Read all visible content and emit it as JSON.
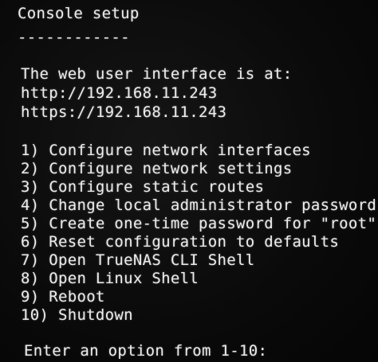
{
  "console": {
    "title": "Console setup",
    "title_rule": "------------",
    "web_ui_label": "The web user interface is at:",
    "http_url": "http://192.168.11.243",
    "https_url": "https://192.168.11.243",
    "menu": [
      {
        "number": "1)",
        "label": "Configure network interfaces"
      },
      {
        "number": "2)",
        "label": "Configure network settings"
      },
      {
        "number": "3)",
        "label": "Configure static routes"
      },
      {
        "number": "4)",
        "label": "Change local administrator password"
      },
      {
        "number": "5)",
        "label": "Create one-time password for \"root\""
      },
      {
        "number": "6)",
        "label": "Reset configuration to defaults"
      },
      {
        "number": "7)",
        "label": "Open TrueNAS CLI Shell"
      },
      {
        "number": "8)",
        "label": "Open Linux Shell"
      },
      {
        "number": "9)",
        "label": "Reboot"
      },
      {
        "number": "10)",
        "label": "Shutdown"
      }
    ],
    "prompt": "Enter an option from 1-10:"
  }
}
